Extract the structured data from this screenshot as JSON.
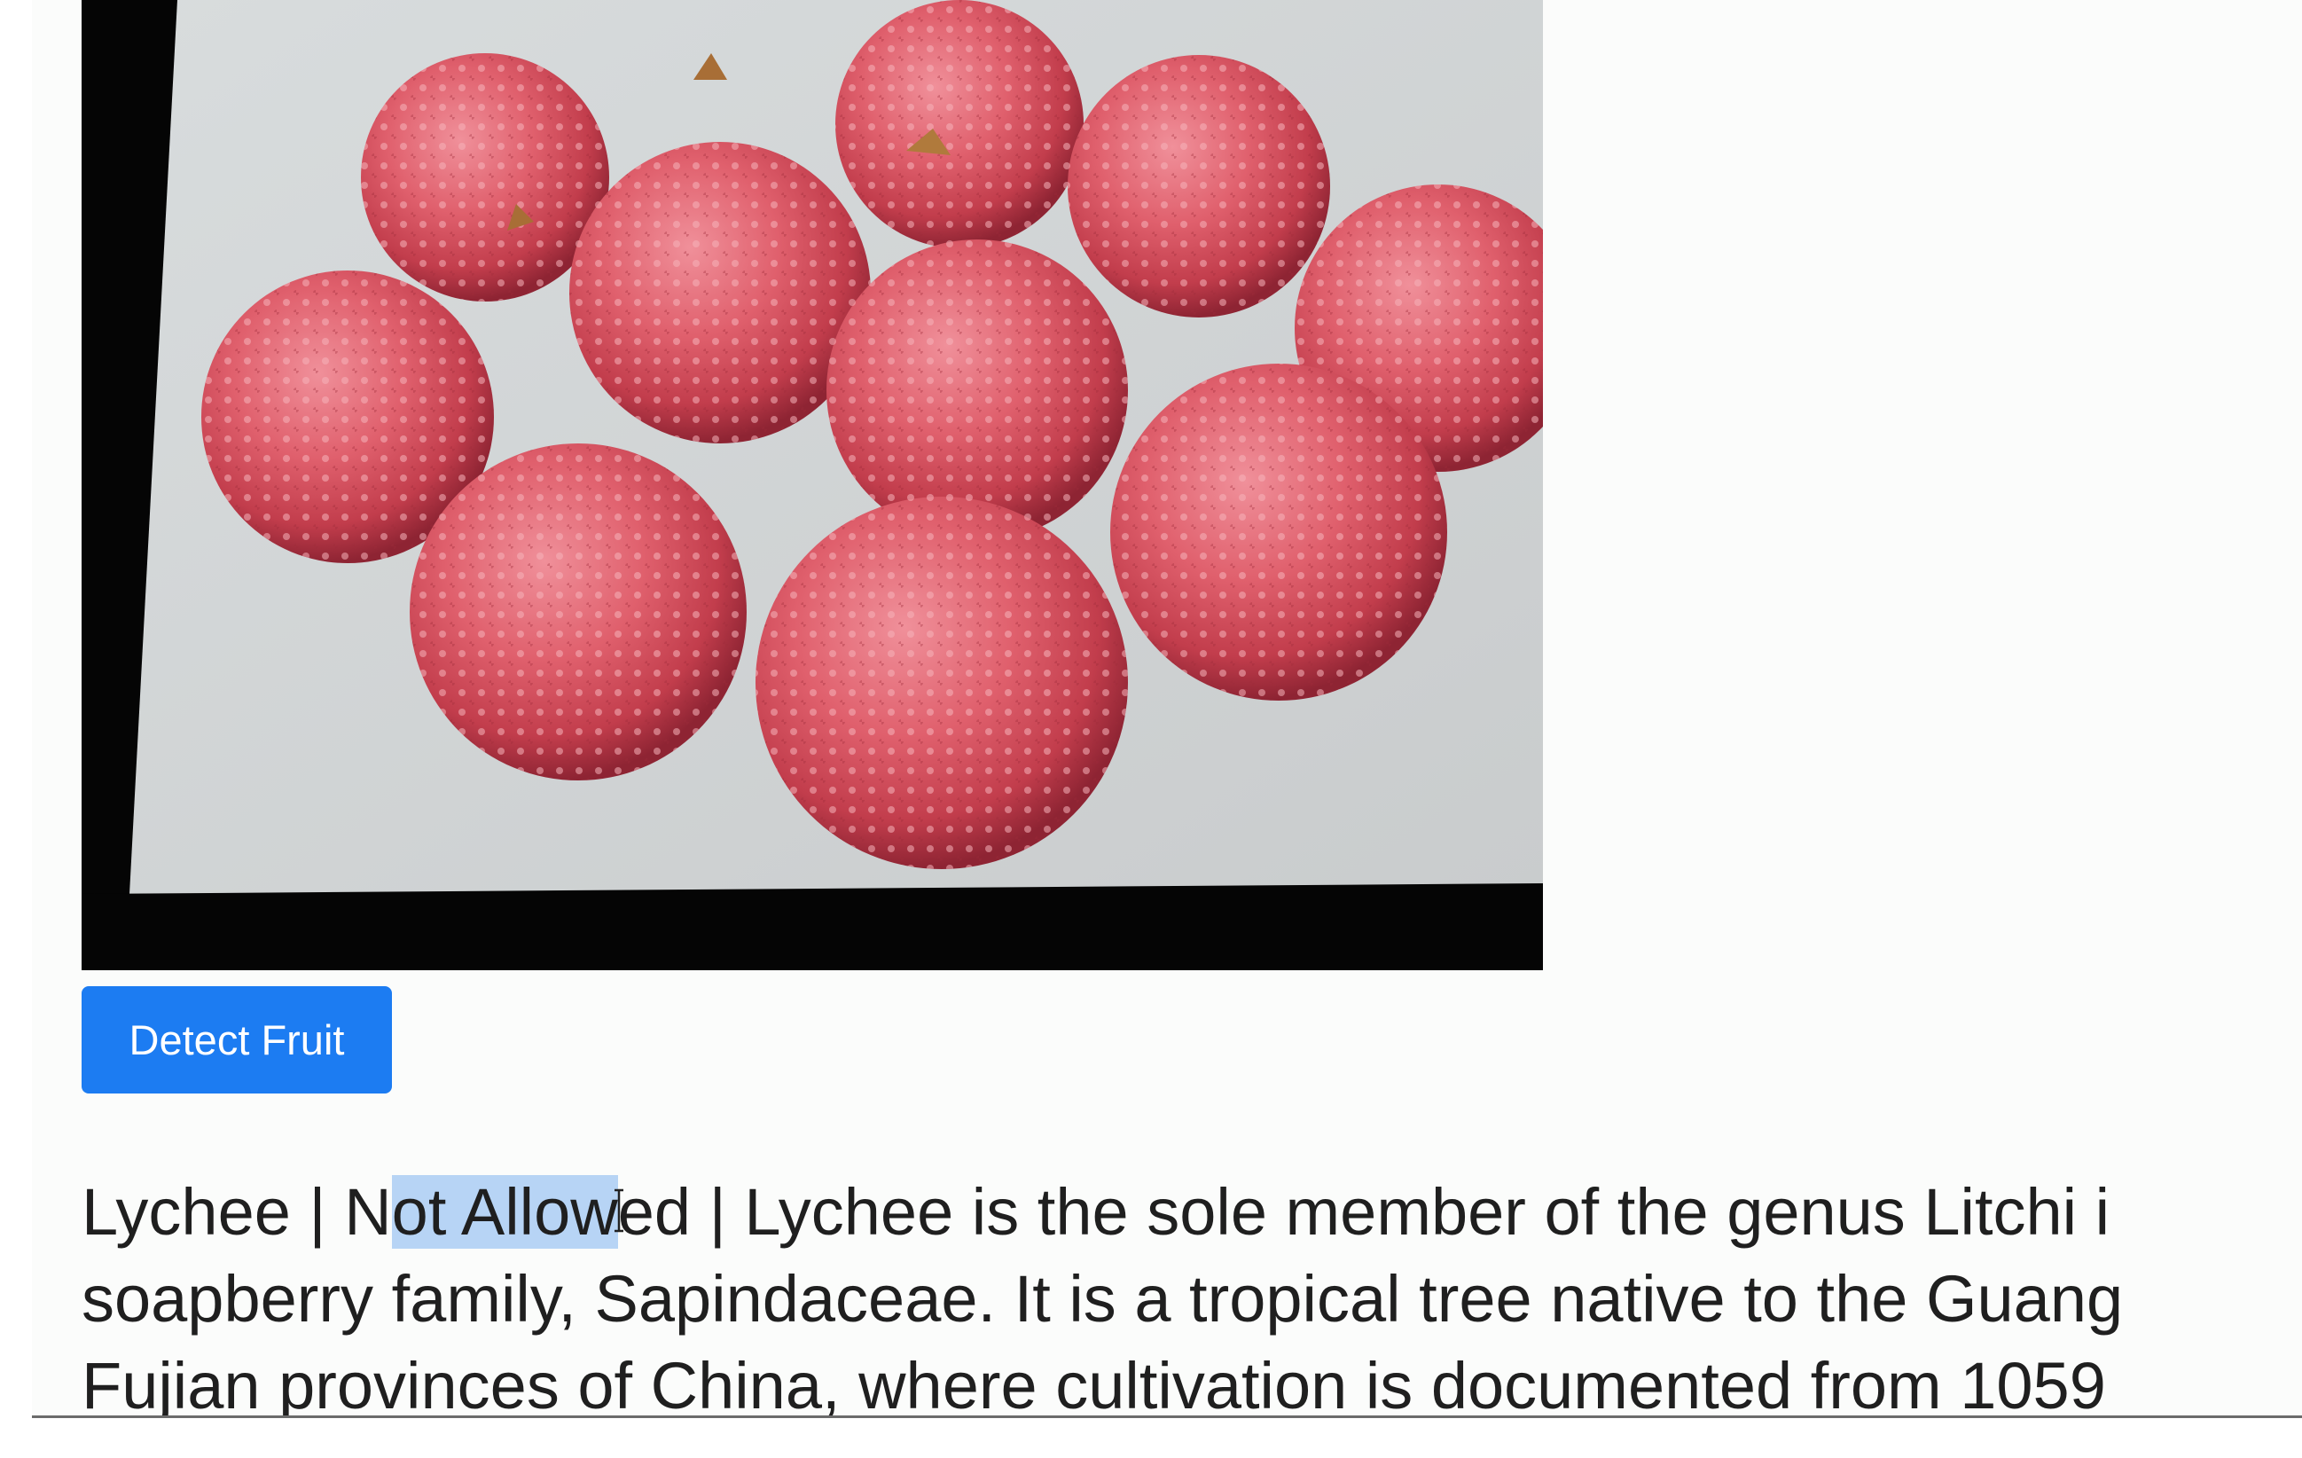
{
  "button": {
    "label": "Detect Fruit"
  },
  "result": {
    "fruit": "Lychee",
    "separator": " | ",
    "status_prefix": "N",
    "status_selected": "ot Allow",
    "status_suffix": "ed",
    "line1_rest": " | Lychee is the sole member of the genus Litchi i",
    "line2": "soapberry family, Sapindaceae. It is a tropical tree native to the Guang",
    "line3": "Fujian provinces of China, where cultivation is documented from 1059"
  },
  "image": {
    "subject": "lychee fruits photo"
  },
  "colors": {
    "button_bg": "#1c7cf2",
    "selection": "#b7d4f5",
    "text": "#1f1f1f"
  }
}
